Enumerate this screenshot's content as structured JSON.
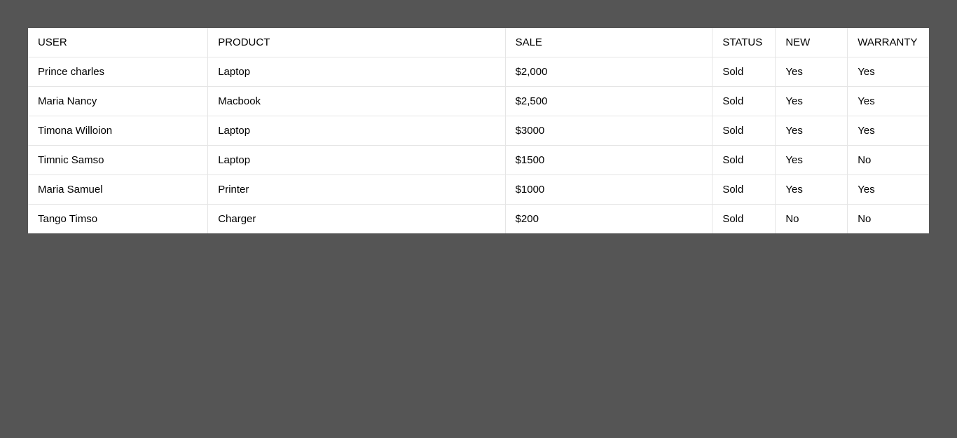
{
  "table": {
    "headers": {
      "user": "USER",
      "product": "PRODUCT",
      "sale": "SALE",
      "status": "STATUS",
      "new": "NEW",
      "warranty": "WARRANTY"
    },
    "rows": [
      {
        "user": "Prince charles",
        "product": "Laptop",
        "sale": "$2,000",
        "status": "Sold",
        "new": "Yes",
        "warranty": "Yes"
      },
      {
        "user": "Maria Nancy",
        "product": "Macbook",
        "sale": "$2,500",
        "status": "Sold",
        "new": "Yes",
        "warranty": "Yes"
      },
      {
        "user": "Timona Willoion",
        "product": "Laptop",
        "sale": "$3000",
        "status": "Sold",
        "new": "Yes",
        "warranty": "Yes"
      },
      {
        "user": "Timnic Samso",
        "product": "Laptop",
        "sale": "$1500",
        "status": "Sold",
        "new": "Yes",
        "warranty": "No"
      },
      {
        "user": "Maria Samuel",
        "product": "Printer",
        "sale": "$1000",
        "status": "Sold",
        "new": "Yes",
        "warranty": "Yes"
      },
      {
        "user": "Tango Timso",
        "product": "Charger",
        "sale": "$200",
        "status": "Sold",
        "new": "No",
        "warranty": "No"
      }
    ]
  }
}
